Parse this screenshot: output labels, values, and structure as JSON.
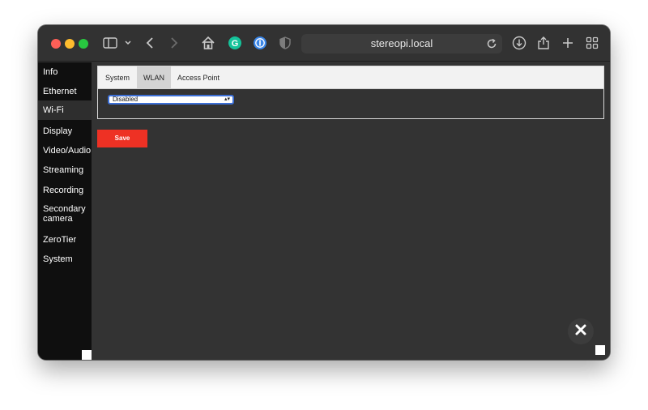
{
  "browser": {
    "url": "stereopi.local",
    "icons": [
      "sidebar-toggle-icon",
      "chevron-down-icon",
      "back-arrow-icon",
      "forward-arrow-icon",
      "home-icon",
      "grammarly-icon",
      "password-manager-icon",
      "privacy-shield-icon",
      "reload-icon",
      "downloads-icon",
      "share-icon",
      "new-tab-icon",
      "tab-overview-icon"
    ]
  },
  "sidebar": {
    "items": [
      {
        "label": "Info"
      },
      {
        "label": "Ethernet"
      },
      {
        "label": "Wi-Fi",
        "active": true
      },
      {
        "label": "Display"
      },
      {
        "label": "Video/Audio"
      },
      {
        "label": "Streaming"
      },
      {
        "label": "Recording"
      },
      {
        "label": "Secondary camera"
      },
      {
        "label": "ZeroTier"
      },
      {
        "label": "System"
      }
    ]
  },
  "tabs": [
    {
      "label": "System"
    },
    {
      "label": "WLAN",
      "active": true
    },
    {
      "label": "Access Point"
    }
  ],
  "wlan": {
    "mode_select": {
      "value": "Disabled"
    }
  },
  "actions": {
    "save_label": "Save"
  },
  "colors": {
    "accent": "#ee3124",
    "background": "#333333",
    "sidebar": "#0f0f0f",
    "focus_ring": "#3c6fd6"
  }
}
